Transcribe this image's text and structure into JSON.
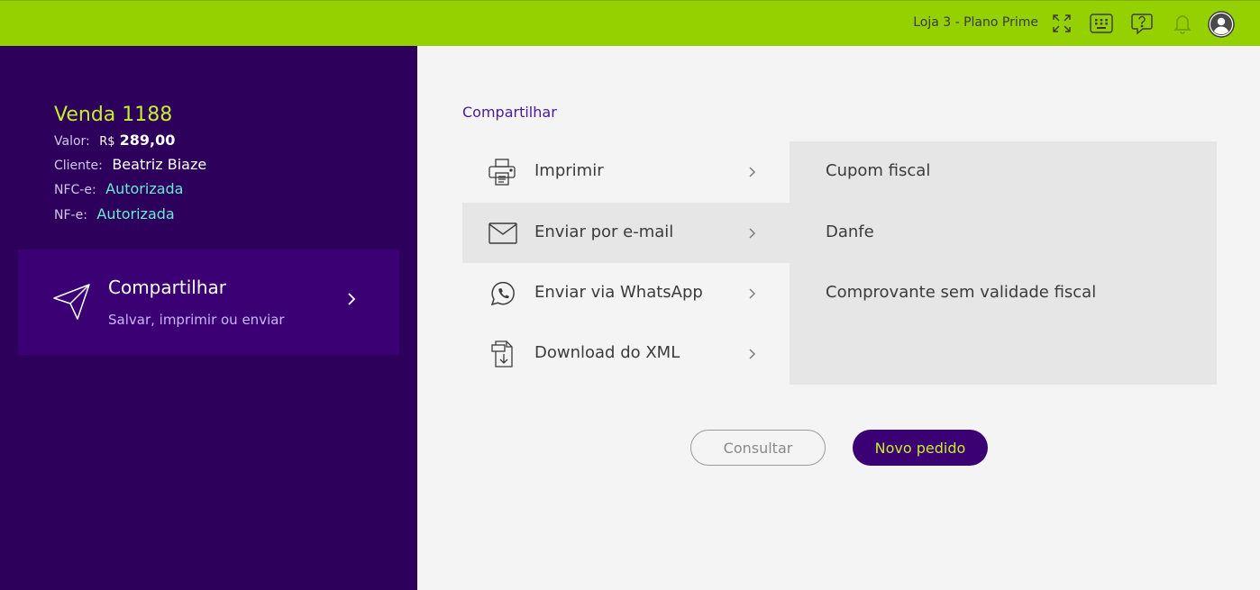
{
  "topbar": {
    "store_label": "Loja 3 - Plano Prime",
    "icons": [
      "expand-icon",
      "keypad-icon",
      "help-chat-icon",
      "bell-icon",
      "user-avatar-icon"
    ],
    "color": "#95d000"
  },
  "sale": {
    "title": "Venda 1188",
    "valor_label": "Valor:",
    "valor_currency": "R$",
    "valor_amount": "289,00",
    "cliente_label": "Cliente:",
    "cliente_value": "Beatriz Biaze",
    "nfce_label": "NFC-e:",
    "nfce_status": "Autorizada",
    "nfe_label": "NF-e:",
    "nfe_status": "Autorizada"
  },
  "share_card": {
    "title": "Compartilhar",
    "subtitle": "Salvar, imprimir ou enviar",
    "icon": "paper-plane-icon"
  },
  "main": {
    "section_title": "Compartilhar",
    "options": [
      {
        "label": "Imprimir",
        "icon": "printer-icon"
      },
      {
        "label": "Enviar por e-mail",
        "icon": "envelope-icon",
        "active": true
      },
      {
        "label": "Enviar via WhatsApp",
        "icon": "whatsapp-icon"
      },
      {
        "label": "Download do XML",
        "icon": "xml-file-icon"
      }
    ],
    "sub_options": [
      "Cupom fiscal",
      "Danfe",
      "Comprovante sem validade fiscal"
    ],
    "buttons": {
      "consultar": "Consultar",
      "novo_pedido": "Novo pedido"
    }
  },
  "colors": {
    "sidebar_bg": "#2d005c",
    "card_bg": "#3b0073",
    "accent_lime": "#c7ee2b",
    "status_teal": "#6fe8d8"
  }
}
